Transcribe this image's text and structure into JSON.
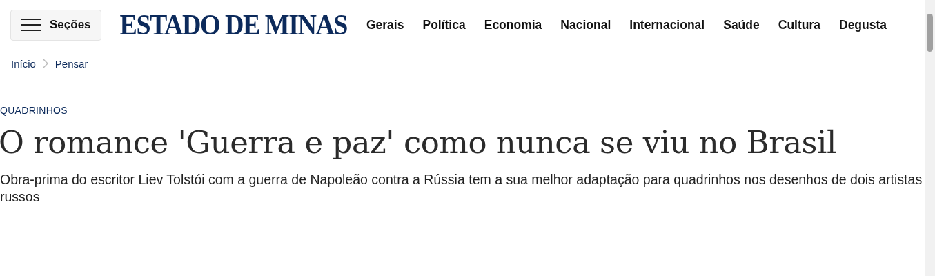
{
  "header": {
    "menu_button": "Seções",
    "logo": "ESTADO DE MINAS",
    "nav": [
      "Gerais",
      "Política",
      "Economia",
      "Nacional",
      "Internacional",
      "Saúde",
      "Cultura",
      "Degusta"
    ]
  },
  "breadcrumb": [
    "Início",
    "Pensar"
  ],
  "article": {
    "category": "QUADRINHOS",
    "title": "O romance 'Guerra e paz' como nunca se viu no Brasil",
    "subtitle": "Obra-prima do escritor Liev Tolstói com a guerra de Napoleão contra a Rússia tem a sua melhor adaptação para quadrinhos nos desenhos de dois artistas russos"
  }
}
